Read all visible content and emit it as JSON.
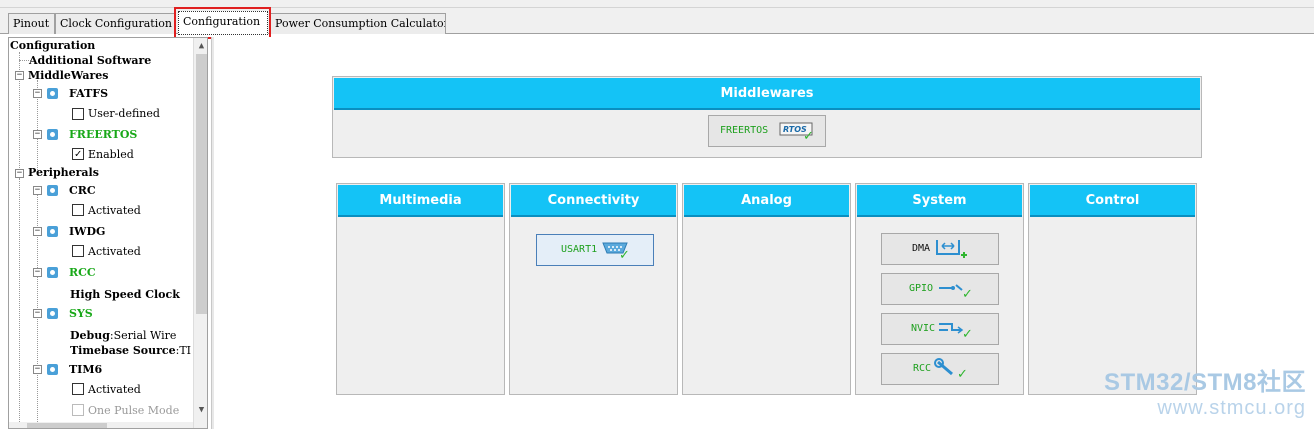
{
  "tabs": [
    {
      "label": "Pinout",
      "active": false
    },
    {
      "label": "Clock Configuration",
      "active": false
    },
    {
      "label": "Configuration",
      "active": true
    },
    {
      "label": "Power Consumption Calculator",
      "active": false
    }
  ],
  "tree": {
    "root": "Configuration",
    "additional": "Additional Software",
    "middlewares": {
      "label": "MiddleWares",
      "fatfs": {
        "label": "FATFS",
        "option": "User-defined",
        "checked": false
      },
      "freertos": {
        "label": "FREERTOS",
        "option": "Enabled",
        "checked": true
      }
    },
    "peripherals": {
      "label": "Peripherals",
      "crc": {
        "label": "CRC",
        "option": "Activated",
        "checked": false
      },
      "iwdg": {
        "label": "IWDG",
        "option": "Activated",
        "checked": false
      },
      "rcc": {
        "label": "RCC",
        "detail": "High Speed Clock"
      },
      "sys": {
        "label": "SYS",
        "debug_key": "Debug",
        "debug_val": ":Serial Wire",
        "timebase_key": "Timebase Source",
        "timebase_val": ":TI"
      },
      "tim6": {
        "label": "TIM6",
        "option": "Activated",
        "checked": false,
        "option2": "One Pulse Mode"
      }
    }
  },
  "middlewares_panel": {
    "title": "Middlewares",
    "buttons": [
      {
        "label": "FREERTOS",
        "icon": "rtos-icon"
      }
    ]
  },
  "categories": [
    {
      "title": "Multimedia",
      "buttons": []
    },
    {
      "title": "Connectivity",
      "buttons": [
        {
          "label": "USART1",
          "icon": "serial-port-icon"
        }
      ]
    },
    {
      "title": "Analog",
      "buttons": []
    },
    {
      "title": "System",
      "buttons": [
        {
          "label": "DMA",
          "icon": "dma-icon"
        },
        {
          "label": "GPIO",
          "icon": "gpio-icon"
        },
        {
          "label": "NVIC",
          "icon": "nvic-icon"
        },
        {
          "label": "RCC",
          "icon": "wrench-icon"
        }
      ]
    },
    {
      "title": "Control",
      "buttons": []
    }
  ],
  "watermark": {
    "line1": "STM32/STM8社区",
    "line2": "www.stmcu.org"
  },
  "colors": {
    "header": "#14c3f6",
    "enabled_text": "#18a818",
    "highlight": "#e02020"
  }
}
